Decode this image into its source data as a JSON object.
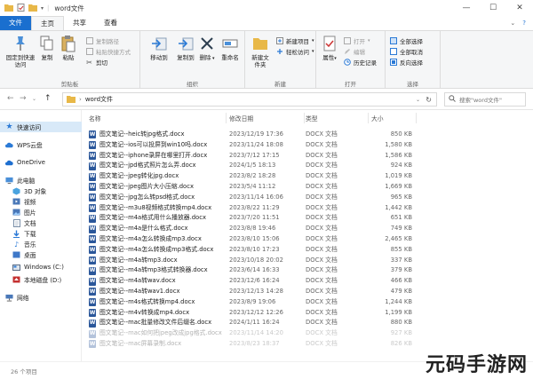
{
  "window": {
    "title": "word文件"
  },
  "tabs": [
    {
      "label": "文件"
    },
    {
      "label": "主页"
    },
    {
      "label": "共享"
    },
    {
      "label": "查看"
    }
  ],
  "ribbon": {
    "clipboard": {
      "label": "剪贴板",
      "pin": "固定到快速访问",
      "copy": "复制",
      "paste": "粘贴",
      "copy_path": "复制路径",
      "paste_shortcut": "粘贴快捷方式",
      "cut": "剪切"
    },
    "organize": {
      "label": "组织",
      "move_to": "移动到",
      "copy_to": "复制到",
      "delete": "删除",
      "rename": "重命名"
    },
    "new": {
      "label": "新建",
      "new_folder": "新建文件夹",
      "new_item": "新建项目",
      "easy_access": "轻松访问"
    },
    "open": {
      "label": "打开",
      "properties": "属性",
      "open": "打开",
      "edit": "编辑",
      "history": "历史记录"
    },
    "select": {
      "label": "选择",
      "select_all": "全部选择",
      "select_none": "全部取消",
      "invert": "反向选择"
    }
  },
  "address": {
    "path": "word文件",
    "search_placeholder": "搜索\"word文件\""
  },
  "sidebar": {
    "items": [
      {
        "label": "快速访问",
        "icon": "star-icon",
        "color": "#2b7ad6"
      },
      {
        "label": "WPS云盘",
        "icon": "cloud-icon",
        "color": "#2b7ad6"
      },
      {
        "label": "OneDrive",
        "icon": "cloud-icon",
        "color": "#1e6fd0"
      },
      {
        "label": "此电脑",
        "icon": "computer-icon",
        "color": "#4a8fd8"
      },
      {
        "label": "3D 对象",
        "icon": "cube-icon",
        "color": "#4aa3df"
      },
      {
        "label": "视频",
        "icon": "video-icon",
        "color": "#4a78b8"
      },
      {
        "label": "图片",
        "icon": "picture-icon",
        "color": "#4a78b8"
      },
      {
        "label": "文档",
        "icon": "document-icon",
        "color": "#7a8fa8"
      },
      {
        "label": "下载",
        "icon": "download-icon",
        "color": "#2b7ad6"
      },
      {
        "label": "音乐",
        "icon": "music-icon",
        "color": "#2b7ad6"
      },
      {
        "label": "桌面",
        "icon": "desktop-icon",
        "color": "#3f78c8"
      },
      {
        "label": "Windows (C:)",
        "icon": "drive-icon",
        "color": "#5a6c84"
      },
      {
        "label": "本地磁盘 (D:)",
        "icon": "drive-icon",
        "color": "#c43030"
      },
      {
        "label": "网络",
        "icon": "network-icon",
        "color": "#4a78b8"
      }
    ]
  },
  "columns": {
    "name": "名称",
    "date": "修改日期",
    "type": "类型",
    "size": "大小"
  },
  "files": [
    {
      "name": "图文笔记--heic转jpg格式.docx",
      "date": "2023/12/19 17:36",
      "type": "DOCX 文档",
      "size": "850 KB"
    },
    {
      "name": "图文笔记--ios可以投屏到win10吗.docx",
      "date": "2023/11/24 18:08",
      "type": "DOCX 文档",
      "size": "1,580 KB"
    },
    {
      "name": "图文笔记--iphone录屏在哪里打开.docx",
      "date": "2023/7/12 17:15",
      "type": "DOCX 文档",
      "size": "1,586 KB"
    },
    {
      "name": "图文笔记--jpd格式照片怎么弄.docx",
      "date": "2024/1/5 18:13",
      "type": "DOCX 文档",
      "size": "924 KB"
    },
    {
      "name": "图文笔记--jpeg转化jpg.docx",
      "date": "2023/8/2 18:28",
      "type": "DOCX 文档",
      "size": "1,019 KB"
    },
    {
      "name": "图文笔记--jpeg图片大小压缩.docx",
      "date": "2023/5/4 11:12",
      "type": "DOCX 文档",
      "size": "1,669 KB"
    },
    {
      "name": "图文笔记--jpg怎么转psd格式.docx",
      "date": "2023/11/14 16:06",
      "type": "DOCX 文档",
      "size": "965 KB"
    },
    {
      "name": "图文笔记--m3u8视频格式转换mp4.docx",
      "date": "2023/8/22 11:29",
      "type": "DOCX 文档",
      "size": "1,442 KB"
    },
    {
      "name": "图文笔记--m4a格式用什么播放器.docx",
      "date": "2023/7/20 11:51",
      "type": "DOCX 文档",
      "size": "651 KB"
    },
    {
      "name": "图文笔记--m4a是什么格式.docx",
      "date": "2023/8/8 19:46",
      "type": "DOCX 文档",
      "size": "749 KB"
    },
    {
      "name": "图文笔记--m4a怎么转换成mp3.docx",
      "date": "2023/8/10 15:06",
      "type": "DOCX 文档",
      "size": "2,465 KB"
    },
    {
      "name": "图文笔记--m4a怎么转换成mp3格式.docx",
      "date": "2023/8/10 17:23",
      "type": "DOCX 文档",
      "size": "855 KB"
    },
    {
      "name": "图文笔记--m4a转mp3.docx",
      "date": "2023/10/18 20:02",
      "type": "DOCX 文档",
      "size": "337 KB"
    },
    {
      "name": "图文笔记--m4a转mp3格式转换器.docx",
      "date": "2023/6/14 16:33",
      "type": "DOCX 文档",
      "size": "379 KB"
    },
    {
      "name": "图文笔记--m4a转wav.docx",
      "date": "2023/12/6 16:24",
      "type": "DOCX 文档",
      "size": "466 KB"
    },
    {
      "name": "图文笔记--m4a转wav1.docx",
      "date": "2023/12/13 14:28",
      "type": "DOCX 文档",
      "size": "479 KB"
    },
    {
      "name": "图文笔记--m4s格式转换mp4.docx",
      "date": "2023/8/9 19:06",
      "type": "DOCX 文档",
      "size": "1,244 KB"
    },
    {
      "name": "图文笔记--m4v转换成mp4.docx",
      "date": "2023/12/12 12:26",
      "type": "DOCX 文档",
      "size": "1,199 KB"
    },
    {
      "name": "图文笔记--mac批量修改文件后缀名.docx",
      "date": "2024/1/11 16:24",
      "type": "DOCX 文档",
      "size": "880 KB"
    },
    {
      "name": "图文笔记--mac如何把jpeg改成jpg格式.docx",
      "date": "2023/11/14 14:20",
      "type": "DOCX 文档",
      "size": "927 KB"
    },
    {
      "name": "图文笔记--mac屏幕录制.docx",
      "date": "2023/8/23 18:37",
      "type": "DOCX 文档",
      "size": "826 KB"
    }
  ],
  "status": {
    "count": "26 个项目"
  },
  "watermark": "元码手游网"
}
